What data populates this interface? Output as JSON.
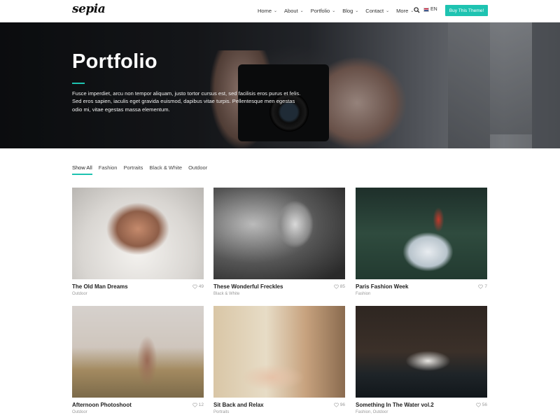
{
  "header": {
    "logo": "sepia",
    "nav": [
      {
        "label": "Home"
      },
      {
        "label": "About"
      },
      {
        "label": "Portfolio"
      },
      {
        "label": "Blog"
      },
      {
        "label": "Contact"
      },
      {
        "label": "More"
      }
    ],
    "lang": "EN",
    "buy_label": "Buy This Theme!",
    "accent": "#1ec3b1"
  },
  "hero": {
    "title": "Portfolio",
    "text": "Fusce imperdiet, arcu non tempor aliquam, justo tortor cursus est, sed facilisis eros purus et felis. Sed eros sapien, iaculis eget gravida euismod, dapibus vitae turpis. Pellentesque men egestas odio mi, vitae egestas massa elementum."
  },
  "filters": [
    "Show All",
    "Fashion",
    "Portraits",
    "Black & White",
    "Outdoor"
  ],
  "items": [
    {
      "title": "The Old Man Dreams",
      "category": "Outdoor",
      "likes": "49"
    },
    {
      "title": "These Wonderful Freckles",
      "category": "Black & White",
      "likes": "85"
    },
    {
      "title": "Paris Fashion Week",
      "category": "Fashion",
      "likes": "7"
    },
    {
      "title": "Afternoon Photoshoot",
      "category": "Outdoor",
      "likes": "12"
    },
    {
      "title": "Sit Back and Relax",
      "category": "Portraits",
      "likes": "96"
    },
    {
      "title": "Something In The Water vol.2",
      "category": "Fashion, Outdoor",
      "likes": "56"
    }
  ]
}
